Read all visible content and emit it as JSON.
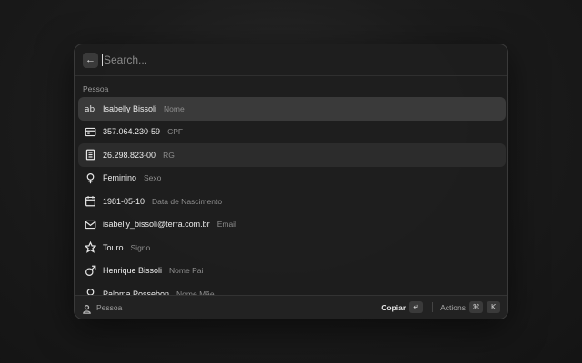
{
  "search": {
    "placeholder": "Search...",
    "back_icon": "arrow-left-icon"
  },
  "section": {
    "title": "Pessoa"
  },
  "items": [
    {
      "icon": "text-ab-icon",
      "title": "Isabelly Bissoli",
      "subtitle": "Nome"
    },
    {
      "icon": "card-icon",
      "title": "357.064.230-59",
      "subtitle": "CPF"
    },
    {
      "icon": "document-icon",
      "title": "26.298.823-00",
      "subtitle": "RG"
    },
    {
      "icon": "female-icon",
      "title": "Feminino",
      "subtitle": "Sexo"
    },
    {
      "icon": "calendar-icon",
      "title": "1981-05-10",
      "subtitle": "Data de Nascimento"
    },
    {
      "icon": "mail-icon",
      "title": "isabelly_bissoli@terra.com.br",
      "subtitle": "Email"
    },
    {
      "icon": "star-icon",
      "title": "Touro",
      "subtitle": "Signo"
    },
    {
      "icon": "male-icon",
      "title": "Henrique Bissoli",
      "subtitle": "Nome Pai"
    },
    {
      "icon": "female-icon",
      "title": "Paloma Possebon",
      "subtitle": "Nome Mãe"
    }
  ],
  "footer": {
    "icon": "person-icon",
    "label": "Pessoa",
    "primary_action": "Copiar",
    "primary_key": "↵",
    "actions_label": "Actions",
    "actions_keys": [
      "⌘",
      "K"
    ]
  },
  "colors": {
    "selected_row": "#3a3a3a",
    "background": "#1e1e1e"
  }
}
